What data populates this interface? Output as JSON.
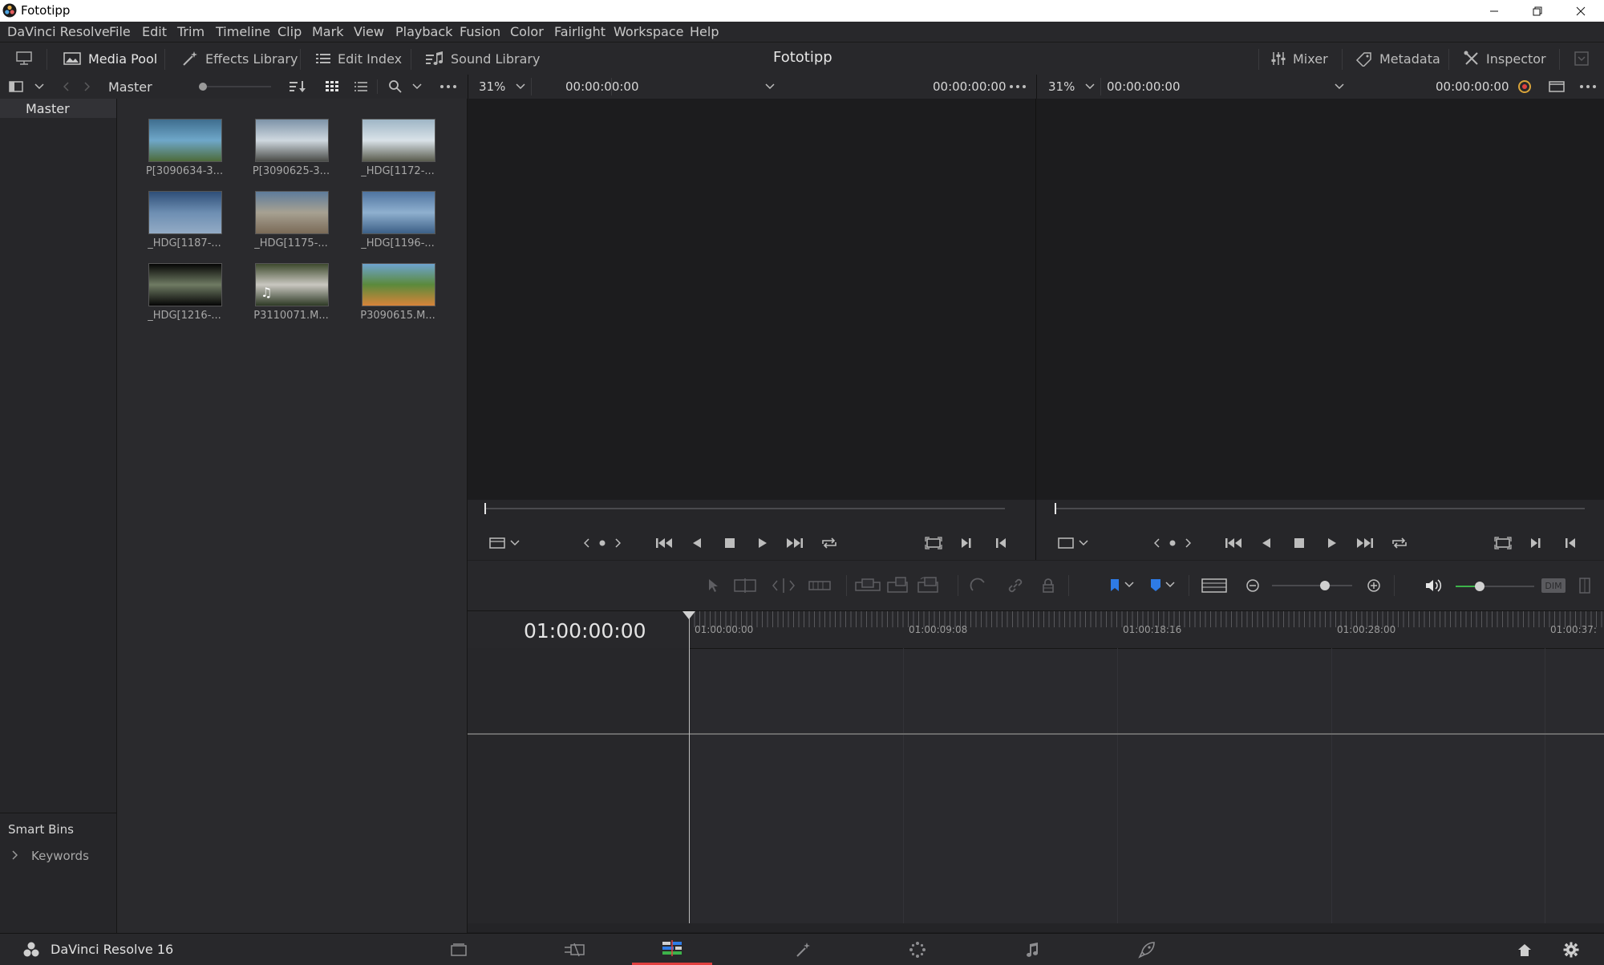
{
  "window": {
    "title": "Fototipp"
  },
  "menu": [
    "DaVinci Resolve",
    "File",
    "Edit",
    "Trim",
    "Timeline",
    "Clip",
    "Mark",
    "View",
    "Playback",
    "Fusion",
    "Color",
    "Fairlight",
    "Workspace",
    "Help"
  ],
  "toolbar": {
    "media_pool": "Media Pool",
    "effects_library": "Effects Library",
    "edit_index": "Edit Index",
    "sound_library": "Sound Library",
    "project_title": "Fototipp",
    "mixer": "Mixer",
    "metadata": "Metadata",
    "inspector": "Inspector"
  },
  "subbar": {
    "bin_name": "Master",
    "source_zoom": "31%",
    "source_timecode": "00:00:00:00",
    "source_duration": "00:00:00:00",
    "timeline_zoom": "31%",
    "timeline_timecode": "00:00:00:00",
    "timeline_duration": "00:00:00:00"
  },
  "bins": {
    "master": "Master",
    "smart_bins": "Smart Bins",
    "keywords": "Keywords"
  },
  "clips": [
    {
      "name": "P[3090634-3...",
      "colors": [
        "#3f6e8f",
        "#6fa7c9",
        "#4d6b3a"
      ],
      "audio": false
    },
    {
      "name": "P[3090625-3...",
      "colors": [
        "#7d93a8",
        "#cfd8df",
        "#4a4c48"
      ],
      "audio": false
    },
    {
      "name": "_HDG[1172-...",
      "colors": [
        "#9fb6c6",
        "#d9e2e8",
        "#5a5c4e"
      ],
      "audio": false
    },
    {
      "name": "_HDG[1187-...",
      "colors": [
        "#2f4f78",
        "#6d8eb2",
        "#93abc5"
      ],
      "audio": false
    },
    {
      "name": "_HDG[1175-...",
      "colors": [
        "#5e7c9b",
        "#a7a192",
        "#7a6a57"
      ],
      "audio": false
    },
    {
      "name": "_HDG[1196-...",
      "colors": [
        "#4f74a0",
        "#8fb0cf",
        "#3c5f86"
      ],
      "audio": false
    },
    {
      "name": "_HDG[1216-...",
      "colors": [
        "#050505",
        "#6f7b63",
        "#050505"
      ],
      "audio": false
    },
    {
      "name": "P3110071.M...",
      "colors": [
        "#3e4a2e",
        "#c9c7c0",
        "#2e3a25"
      ],
      "audio": true
    },
    {
      "name": "P3090615.M...",
      "colors": [
        "#6ea4cf",
        "#5b8a3b",
        "#d7843a"
      ],
      "audio": false
    }
  ],
  "timeline": {
    "timecode": "01:00:00:00",
    "ruler": [
      "01:00:00:00",
      "01:00:09:08",
      "01:00:18:16",
      "01:00:28:00",
      "01:00:37:"
    ]
  },
  "viewer_controls": {
    "dim_label": "DIM"
  },
  "bottom": {
    "app_name": "DaVinci Resolve 16"
  },
  "pages": [
    "media",
    "cut",
    "edit",
    "fusion",
    "color",
    "fairlight",
    "deliver"
  ],
  "active_page": "edit",
  "colors": {
    "accent_red": "#e0403f",
    "accent_blue": "#2e7be6",
    "accent_green": "#3db34a"
  }
}
